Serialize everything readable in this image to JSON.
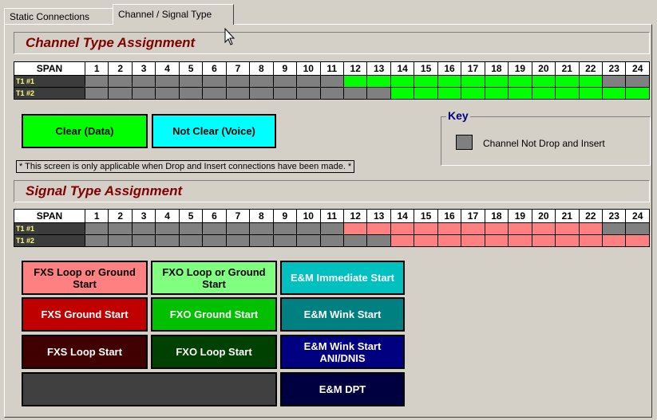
{
  "tabs": [
    {
      "label": "Static Connections",
      "active": false
    },
    {
      "label": "Channel / Signal Type",
      "active": true
    }
  ],
  "channel_section": {
    "title": "Channel Type Assignment",
    "title_color": "#800000",
    "span_header": "SPAN",
    "columns": [
      "1",
      "2",
      "3",
      "4",
      "5",
      "6",
      "7",
      "8",
      "9",
      "10",
      "11",
      "12",
      "13",
      "14",
      "15",
      "16",
      "17",
      "18",
      "19",
      "20",
      "21",
      "22",
      "23",
      "24"
    ],
    "rows": [
      {
        "label": "T1 #1",
        "cells": [
          "gray",
          "gray",
          "gray",
          "gray",
          "gray",
          "gray",
          "gray",
          "gray",
          "gray",
          "gray",
          "gray",
          "green",
          "green",
          "green",
          "green",
          "green",
          "green",
          "green",
          "green",
          "green",
          "green",
          "green",
          "gray",
          "gray"
        ]
      },
      {
        "label": "T1 #2",
        "cells": [
          "gray",
          "gray",
          "gray",
          "gray",
          "gray",
          "gray",
          "gray",
          "gray",
          "gray",
          "gray",
          "gray",
          "gray",
          "gray",
          "green",
          "green",
          "green",
          "green",
          "green",
          "green",
          "green",
          "green",
          "green",
          "green",
          "green"
        ]
      }
    ],
    "buttons": [
      {
        "label": "Clear (Data)",
        "color": "#00ff00"
      },
      {
        "label": "Not Clear (Voice)",
        "color": "#00ffff"
      }
    ],
    "note": "* This screen is only applicable when Drop and Insert connections have been made. *"
  },
  "key": {
    "title": "Key",
    "item_label": "Channel Not Drop and Insert",
    "item_color": "#808080"
  },
  "signal_section": {
    "title": "Signal Type Assignment",
    "title_color": "#800000",
    "span_header": "SPAN",
    "columns": [
      "1",
      "2",
      "3",
      "4",
      "5",
      "6",
      "7",
      "8",
      "9",
      "10",
      "11",
      "12",
      "13",
      "14",
      "15",
      "16",
      "17",
      "18",
      "19",
      "20",
      "21",
      "22",
      "23",
      "24"
    ],
    "rows": [
      {
        "label": "T1 #1",
        "cells": [
          "gray",
          "gray",
          "gray",
          "gray",
          "gray",
          "gray",
          "gray",
          "gray",
          "gray",
          "gray",
          "gray",
          "pink",
          "pink",
          "pink",
          "pink",
          "pink",
          "pink",
          "pink",
          "pink",
          "pink",
          "pink",
          "pink",
          "gray",
          "gray"
        ]
      },
      {
        "label": "T1 #2",
        "cells": [
          "gray",
          "gray",
          "gray",
          "gray",
          "gray",
          "gray",
          "gray",
          "gray",
          "gray",
          "gray",
          "gray",
          "gray",
          "gray",
          "pink",
          "pink",
          "pink",
          "pink",
          "pink",
          "pink",
          "pink",
          "pink",
          "pink",
          "pink",
          "pink"
        ]
      }
    ],
    "buttons": {
      "fxs_loop_or_ground": {
        "label": "FXS Loop or Ground Start",
        "bg": "#ff8080",
        "fg": "#000000"
      },
      "fxo_loop_or_ground": {
        "label": "FXO Loop or Ground Start",
        "bg": "#80ff80",
        "fg": "#000000"
      },
      "em_immediate": {
        "label": "E&M Immediate Start",
        "bg": "#00c0c0",
        "fg": "#ffffff"
      },
      "fxs_ground": {
        "label": "FXS Ground Start",
        "bg": "#c00000",
        "fg": "#ffffff"
      },
      "fxo_ground": {
        "label": "FXO Ground Start",
        "bg": "#00c000",
        "fg": "#ffffff"
      },
      "em_wink": {
        "label": "E&M Wink Start",
        "bg": "#008080",
        "fg": "#ffffff"
      },
      "fxs_loop": {
        "label": "FXS Loop Start",
        "bg": "#400000",
        "fg": "#ffffff"
      },
      "fxo_loop": {
        "label": "FXO Loop Start",
        "bg": "#004000",
        "fg": "#ffffff"
      },
      "em_wink_ani": {
        "label": "E&M Wink Start ANI/DNIS",
        "bg": "#000080",
        "fg": "#ffffff"
      },
      "blank": {
        "label": "",
        "bg": "#404040",
        "fg": "#ffffff"
      },
      "em_dpt": {
        "label": "E&M DPT",
        "bg": "#000040",
        "fg": "#ffffff"
      }
    }
  }
}
